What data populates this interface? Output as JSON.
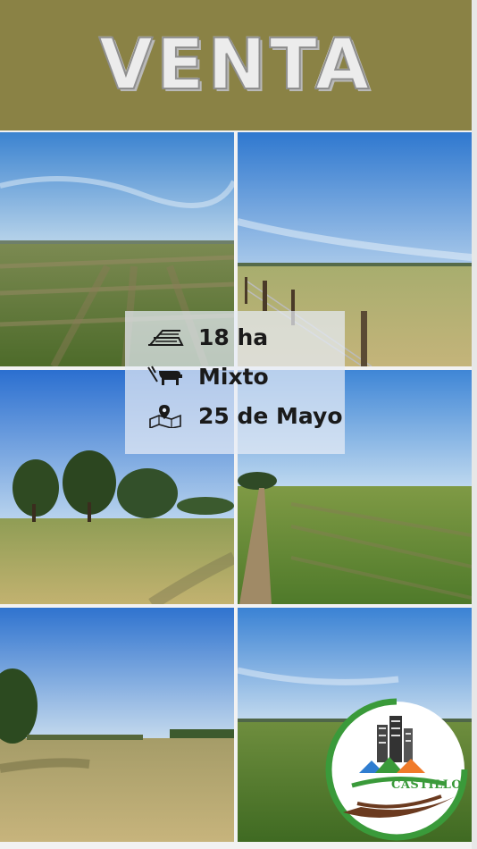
{
  "header": {
    "title": "VENTA"
  },
  "features": [
    {
      "icon": "area-icon",
      "text": "18 ha"
    },
    {
      "icon": "livestock-crop-icon",
      "text": "Mixto"
    },
    {
      "icon": "location-map-icon",
      "text": "25 de Mayo"
    }
  ],
  "logo": {
    "text": "CASTILLO"
  },
  "colors": {
    "header_bg": "#8a8245",
    "logo_green": "#3a9a3a",
    "logo_brown": "#6b3a1f",
    "logo_orange": "#f07b2a"
  }
}
